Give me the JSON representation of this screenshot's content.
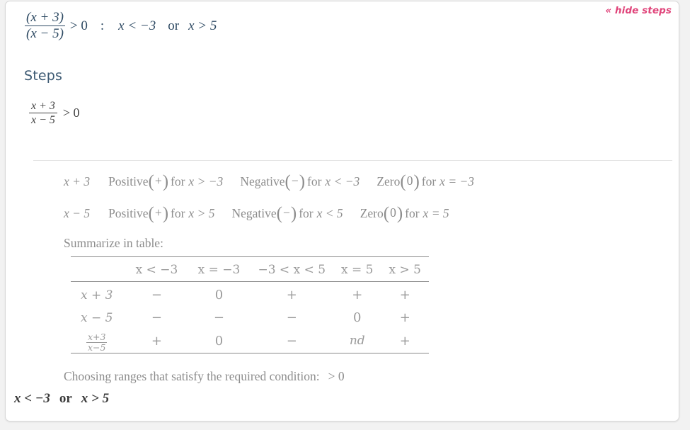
{
  "panel": {
    "toggle_link": "« hide steps",
    "steps_heading": "Steps"
  },
  "headline": {
    "numerator": "(x + 3)",
    "denominator": "(x − 5)",
    "relation": "> 0",
    "separator": ":",
    "answer_left": "x < −3",
    "answer_or": "or",
    "answer_right": "x > 5"
  },
  "restated": {
    "numerator": "x + 3",
    "denominator": "x − 5",
    "relation": "> 0"
  },
  "sign_analysis": [
    {
      "expression": "x + 3",
      "positive_word": "Positive",
      "positive_symbol": "+",
      "positive_for": "x > −3",
      "negative_word": "Negative",
      "negative_symbol": "−",
      "negative_for": "x < −3",
      "zero_word": "Zero",
      "zero_symbol": "0",
      "zero_for": "x = −3",
      "for_word": "for"
    },
    {
      "expression": "x − 5",
      "positive_word": "Positive",
      "positive_symbol": "+",
      "positive_for": "x > 5",
      "negative_word": "Negative",
      "negative_symbol": "−",
      "negative_for": "x < 5",
      "zero_word": "Zero",
      "zero_symbol": "0",
      "zero_for": "x = 5",
      "for_word": "for"
    }
  ],
  "table": {
    "caption": "Summarize in table:",
    "columns": [
      "x < −3",
      "x = −3",
      "−3 < x < 5",
      "x = 5",
      "x > 5"
    ],
    "rows": [
      {
        "label": "x + 3",
        "label_type": "plain",
        "values": [
          "−",
          "0",
          "+",
          "+",
          "+"
        ]
      },
      {
        "label": "x − 5",
        "label_type": "plain",
        "values": [
          "−",
          "−",
          "−",
          "0",
          "+"
        ]
      },
      {
        "label_type": "fraction",
        "label_numerator": "x+3",
        "label_denominator": "x−5",
        "values": [
          "+",
          "0",
          "−",
          "nd",
          "+"
        ]
      }
    ]
  },
  "choosing": {
    "text": "Choosing ranges that satisfy the required condition:",
    "condition": "> 0"
  },
  "final_answer": {
    "left": "x < −3",
    "or": "or",
    "right": "x > 5"
  },
  "colors": {
    "link": "#e0447a",
    "headline": "#2e4a63",
    "heading": "#3d5a73",
    "muted": "#8d8d8d",
    "table": "#9a9a9a",
    "final": "#3a3a3a",
    "card_bg": "#ffffff",
    "page_bg": "#f2f2f2",
    "border": "#d8d8d8"
  }
}
